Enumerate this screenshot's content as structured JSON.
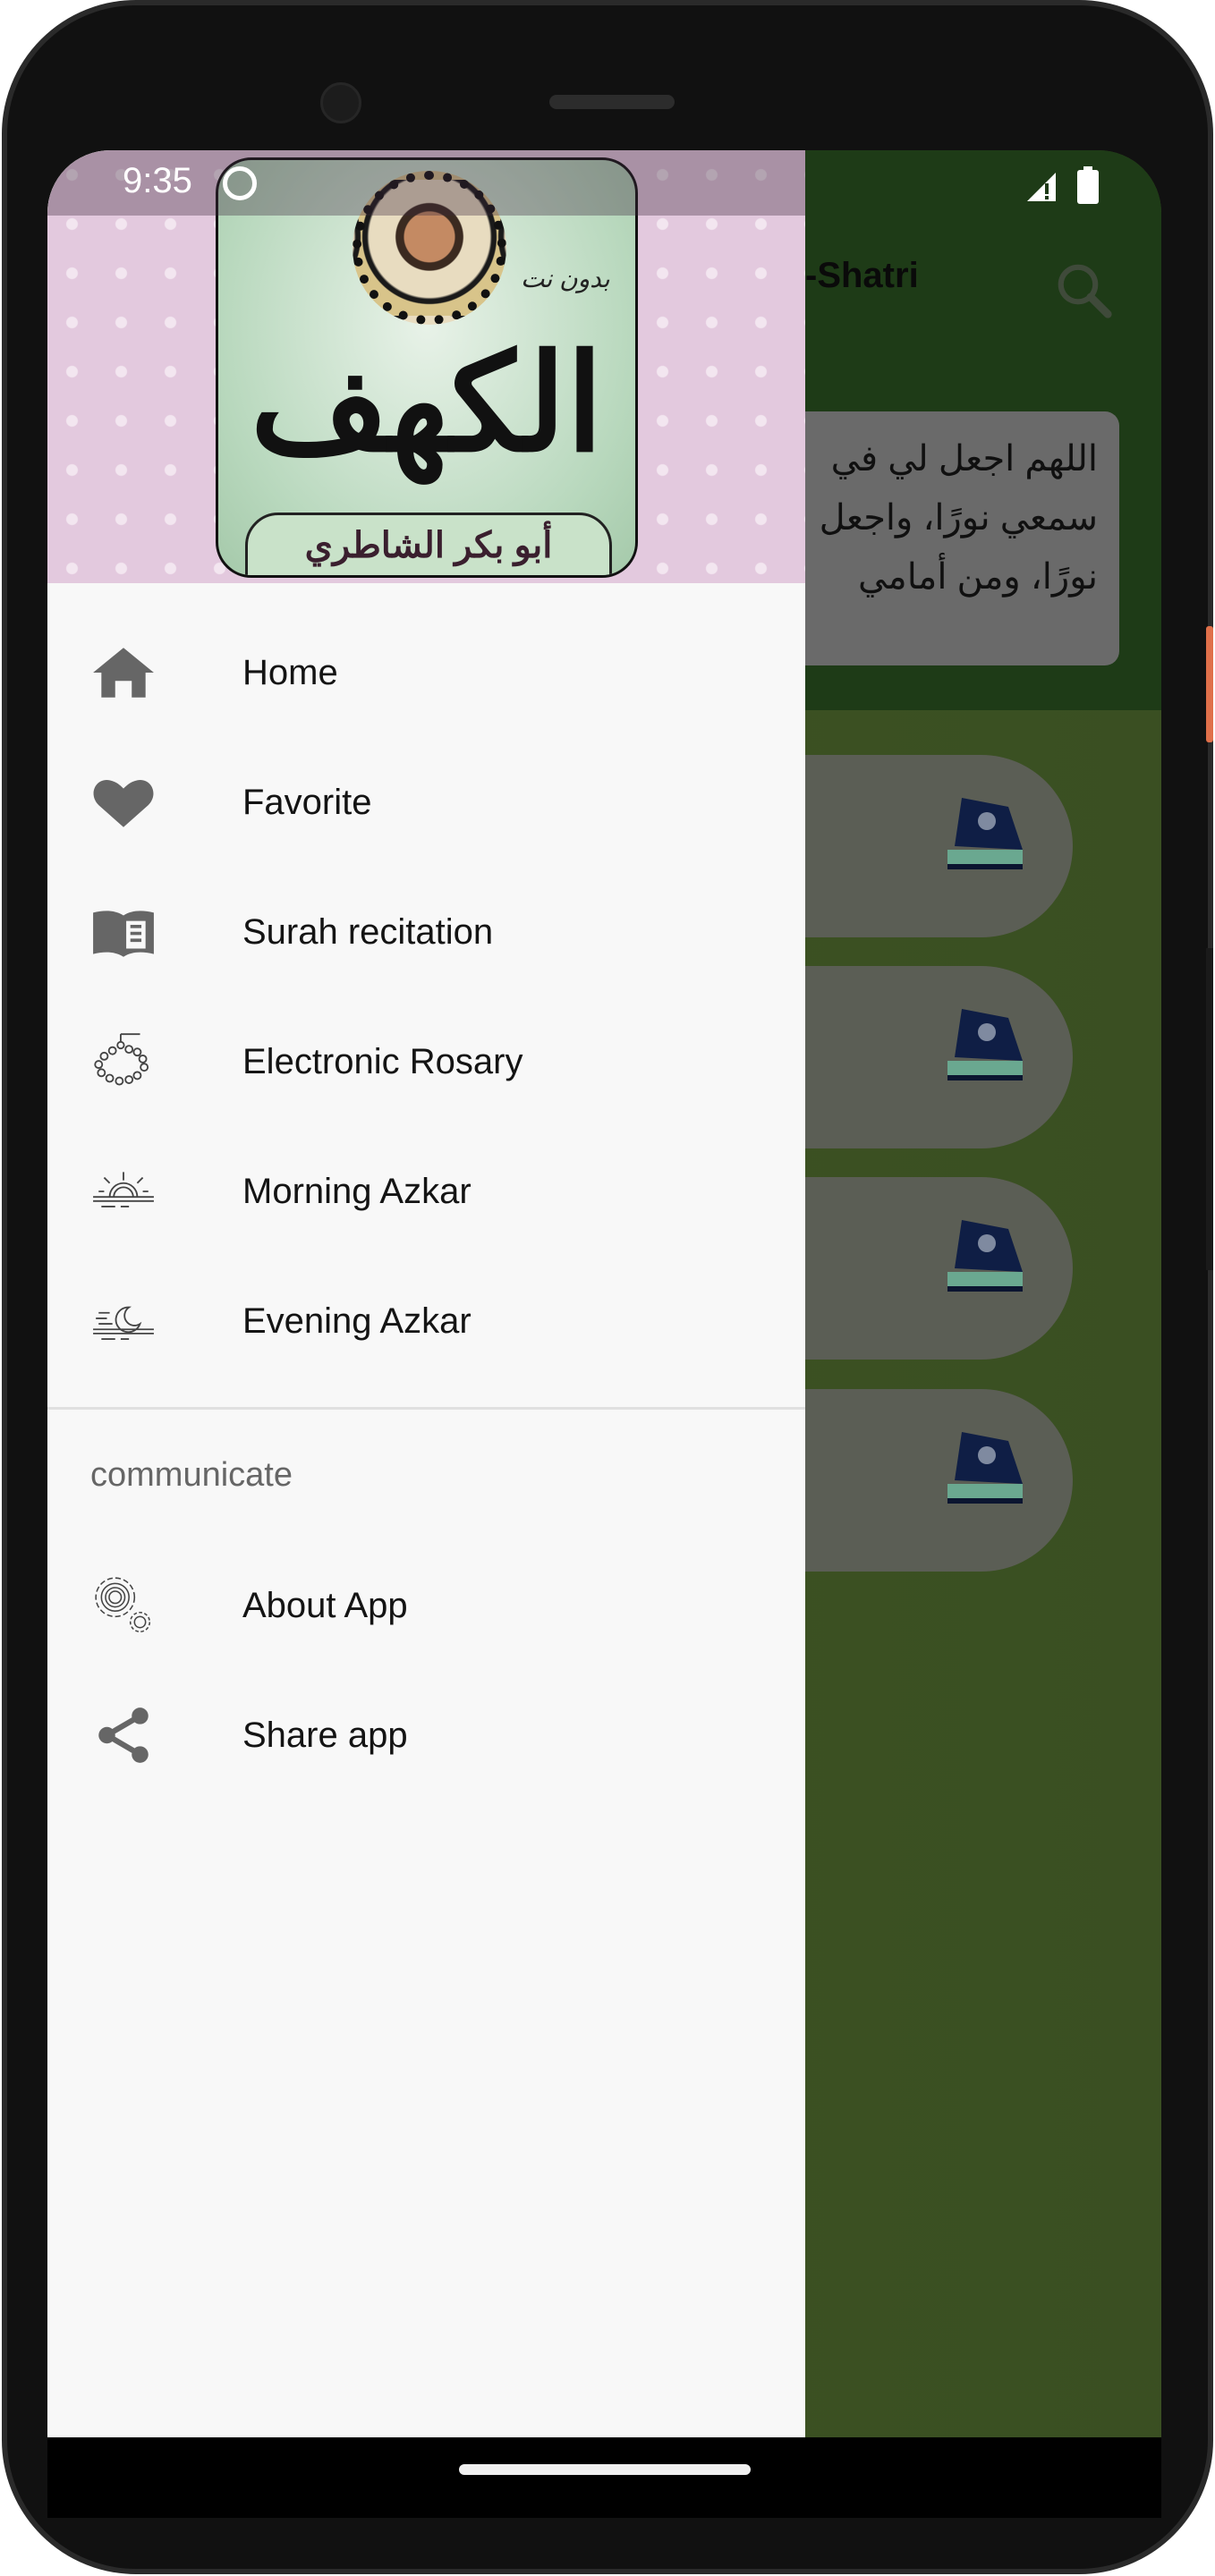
{
  "status_bar": {
    "time": "9:35"
  },
  "app_bar": {
    "title": "-Shatri",
    "search_icon": "search-icon"
  },
  "dua_card": {
    "lines": [
      "اللهم اجعل لي في",
      "سمعي نورًا، واجعل",
      "نورًا، ومن أمامي"
    ]
  },
  "list_pills": [
    {
      "icon": "quran-book-icon"
    },
    {
      "icon": "quran-book-icon"
    },
    {
      "icon": "quran-book-icon"
    },
    {
      "icon": "quran-book-icon"
    }
  ],
  "drawer": {
    "header": {
      "cover_title": "الكهف",
      "cover_subtitle": "بدون نت",
      "cover_reciter": "أبو بكر الشاطري"
    },
    "items": [
      {
        "label": "Home",
        "icon": "home-icon"
      },
      {
        "label": "Favorite",
        "icon": "heart-icon"
      },
      {
        "label": "Surah recitation",
        "icon": "open-book-icon"
      },
      {
        "label": "Electronic Rosary",
        "icon": "rosary-icon"
      },
      {
        "label": "Morning Azkar",
        "icon": "sunrise-icon"
      },
      {
        "label": "Evening Azkar",
        "icon": "moon-icon"
      }
    ],
    "section_title": "communicate",
    "section_items": [
      {
        "label": "About App",
        "icon": "gears-icon"
      },
      {
        "label": "Share app",
        "icon": "share-icon"
      }
    ]
  },
  "colors": {
    "app_bar": "#1e3b17",
    "background": "#3b5120",
    "drawer": "#f8f8f8",
    "header_pink": "#e3c9de",
    "icon_gray": "#666666"
  }
}
